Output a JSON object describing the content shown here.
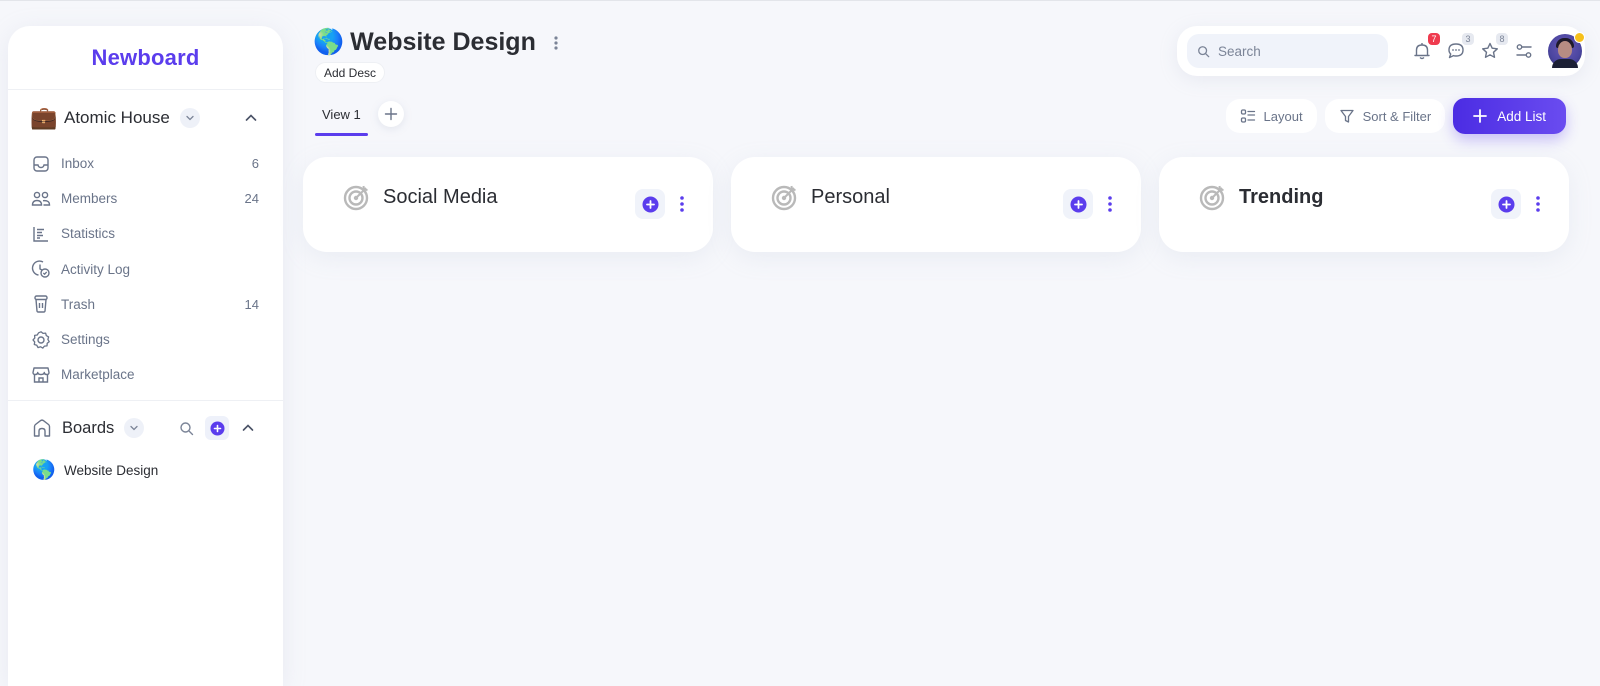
{
  "sidebar": {
    "brand": "Newboard",
    "workspace": {
      "name": "Atomic House",
      "emoji": "💼"
    },
    "nav": [
      {
        "label": "Inbox",
        "count": "6",
        "icon": "inbox-icon"
      },
      {
        "label": "Members",
        "count": "24",
        "icon": "members-icon"
      },
      {
        "label": "Statistics",
        "count": "",
        "icon": "statistics-icon"
      },
      {
        "label": "Activity Log",
        "count": "",
        "icon": "activity-log-icon"
      },
      {
        "label": "Trash",
        "count": "14",
        "icon": "trash-icon"
      },
      {
        "label": "Settings",
        "count": "",
        "icon": "gear-icon"
      },
      {
        "label": "Marketplace",
        "count": "",
        "icon": "store-icon"
      }
    ],
    "boards": {
      "label": "Boards",
      "items": [
        {
          "label": "Website Design",
          "emoji": "🌎"
        }
      ]
    }
  },
  "header": {
    "emoji": "🌎",
    "title": "Website Design",
    "add_desc": "Add Desc",
    "tabs": [
      {
        "label": "View 1",
        "active": true
      }
    ]
  },
  "topbar": {
    "search_placeholder": "Search",
    "notifications_count": "7",
    "messages_count": "3",
    "favorites_count": "8"
  },
  "toolbar": {
    "layout_label": "Layout",
    "sort_filter_label": "Sort & Filter",
    "add_list_label": "Add List"
  },
  "lists": [
    {
      "name": "Social Media"
    },
    {
      "name": "Personal"
    },
    {
      "name": "Trending"
    }
  ],
  "colors": {
    "accent": "#5b3ded",
    "badge_red": "#ef3b4f",
    "muted_text": "#6a7489",
    "background": "#f6f7fb"
  }
}
